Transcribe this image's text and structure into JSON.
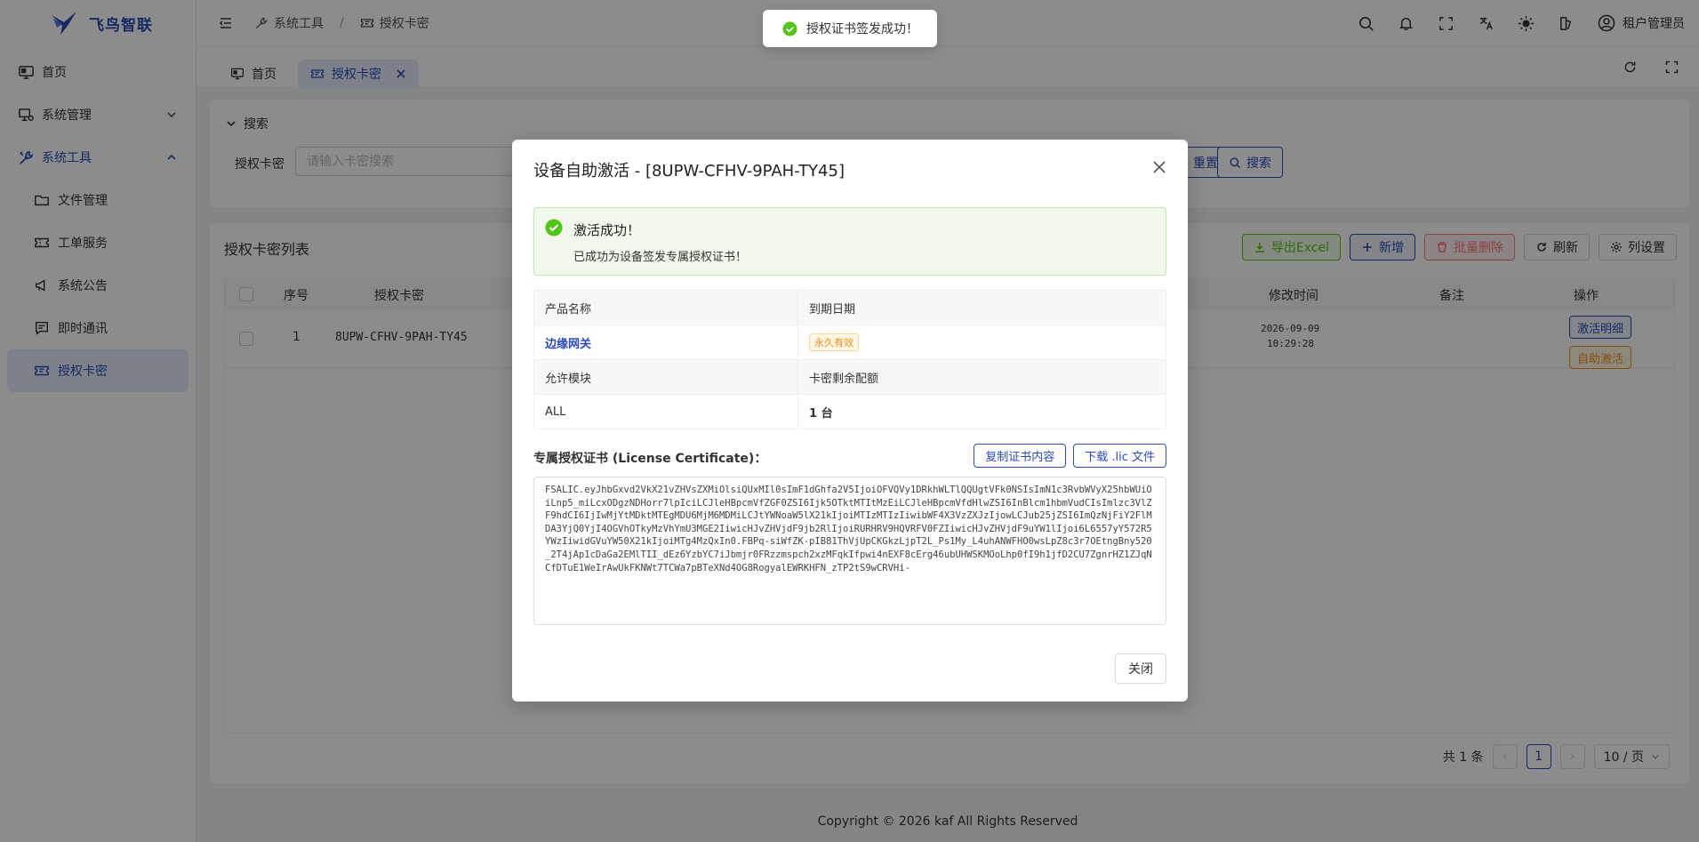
{
  "app": {
    "brand": "飞鸟智联"
  },
  "sidebar": {
    "items": [
      {
        "label": "首页",
        "icon": "monitor-icon"
      },
      {
        "label": "系统管理",
        "icon": "computer-settings-icon"
      },
      {
        "label": "系统工具",
        "icon": "tools-icon"
      }
    ],
    "sub_items": [
      {
        "label": "文件管理",
        "icon": "folder-icon"
      },
      {
        "label": "工单服务",
        "icon": "ticket-icon"
      },
      {
        "label": "系统公告",
        "icon": "megaphone-icon"
      },
      {
        "label": "即时通讯",
        "icon": "chat-icon"
      },
      {
        "label": "授权卡密",
        "icon": "card-icon"
      }
    ]
  },
  "header": {
    "breadcrumb": [
      "系统工具",
      "授权卡密"
    ],
    "user": "租户管理员"
  },
  "tabs": [
    {
      "label": "首页"
    },
    {
      "label": "授权卡密"
    }
  ],
  "search": {
    "section_title": "搜索",
    "field_label": "授权卡密",
    "placeholder": "请输入卡密搜索",
    "reset_label": "重置",
    "search_label": "搜索"
  },
  "list": {
    "title": "授权卡密列表",
    "toolbar": {
      "export": "导出Excel",
      "add": "新增",
      "batch_delete": "批量删除",
      "refresh": "刷新",
      "columns": "列设置"
    },
    "columns": [
      "序号",
      "授权卡密",
      "修改时间",
      "备注",
      "操作"
    ],
    "rows": [
      {
        "index": "1",
        "code": "8UPW-CFHV-9PAH-TY45",
        "modified_date": "2026-09-09",
        "modified_time": "10:29:28",
        "remark": "",
        "actions": [
          "激活明细",
          "自助激活"
        ]
      }
    ],
    "pager": {
      "total": "共 1 条",
      "current": "1",
      "size": "10 / 页"
    }
  },
  "footer": "Copyright © 2026 kaf All Rights Reserved",
  "toast": "授权证书签发成功！",
  "modal": {
    "title": "设备自助激活 - [8UPW-CFHV-9PAH-TY45]",
    "alert_title": "激活成功！",
    "alert_desc": "已成功为设备签发专属授权证书！",
    "info": {
      "product_label": "产品名称",
      "expiry_label": "到期日期",
      "product_value": "边缘网关",
      "expiry_value": "永久有效",
      "modules_label": "允许模块",
      "quota_label": "卡密剩余配额",
      "modules_value": "ALL",
      "quota_value": "1 台"
    },
    "cert_label": "专属授权证书 (License Certificate)：",
    "copy_label": "复制证书内容",
    "download_label": "下载 .lic 文件",
    "certificate": "FSALIC.eyJhbGxvd2VkX21vZHVsZXMiOlsiQUxMIl0sImF1dGhfa2V5IjoiOFVQVy1DRkhWLTlQQUgtVFk0NSIsImN1c3RvbWVyX25hbWUiOiLnp5_miLcxODgzNDHorr7lpIciLCJleHBpcmVfZGF0ZSI6Ijk5OTktMTItMzEiLCJleHBpcmVfdHlwZSI6InBlcm1hbmVudCIsImlzc3VlZF9hdCI6IjIwMjYtMDktMTEgMDU6MjM6MDMiLCJtYWNoaW5lX21kIjoiMTIzMTIzIiwibWF4X3VzZXJzIjowLCJub25jZSI6ImQzNjFiY2FlMDA3YjQ0YjI4OGVhOTkyMzVhYmU3MGE2IiwicHJvZHVjdF9jb2RlIjoiRURHRV9HQVRFV0FZIiwicHJvZHVjdF9uYW1lIjoi6L6557yY572R5YWzIiwidGVuYW50X21kIjoiMTg4MzQxIn0.FBPq-siWfZK-pIB81ThVjUpCKGkzLjpT2L_Ps1My_L4uhANWFHO0wsLpZ8c3r7OEtngBny520_2T4jAp1cDaGa2EMlTII_dEz6YzbYC7iJbmjr0FRzzmspch2xzMFqkIfpwi4nEXF8cErg46ubUHWSKMOoLhp0fI9h1jfD2CU7ZgnrHZ1ZJqNCfDTuE1WeIrAwUkFKNWt7TCWa7pBTeXNd4OG8RogyalEWRKHFN_zTP2tS9wCRVHi-",
    "close_label": "关闭"
  },
  "colors": {
    "primary": "#2b4cb8",
    "success": "#52c41a",
    "warning": "#fa8c16",
    "danger": "#ff7875"
  }
}
